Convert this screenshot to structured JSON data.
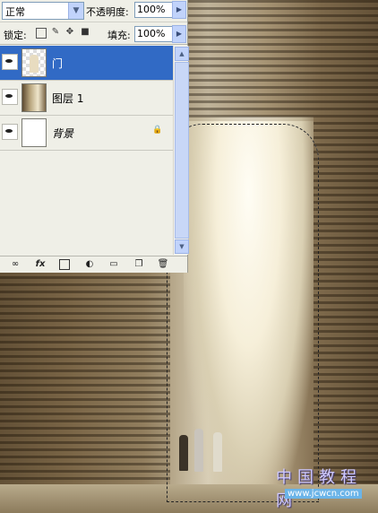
{
  "layers_panel": {
    "blend_mode": "正常",
    "opacity_label": "不透明度:",
    "opacity_value": "100%",
    "lock_label": "锁定:",
    "fill_label": "填充:",
    "fill_value": "100%",
    "layers": [
      {
        "name": "门",
        "selected": true,
        "thumb_icon": "transparent-thumb-icon"
      },
      {
        "name": "图层 1",
        "selected": false,
        "thumb_icon": "photo-thumb-icon"
      },
      {
        "name": "背景",
        "selected": false,
        "thumb_icon": "white-thumb-icon",
        "locked": true
      }
    ],
    "bottom_buttons": [
      "link-icon",
      "fx-icon",
      "mask-icon",
      "adjustment-icon",
      "folder-icon",
      "new-layer-icon",
      "trash-icon"
    ],
    "fx_label": "fx",
    "selected_color": "#316ac5"
  },
  "watermark": {
    "text": "中国教程网",
    "url": "www.jcwcn.com"
  }
}
